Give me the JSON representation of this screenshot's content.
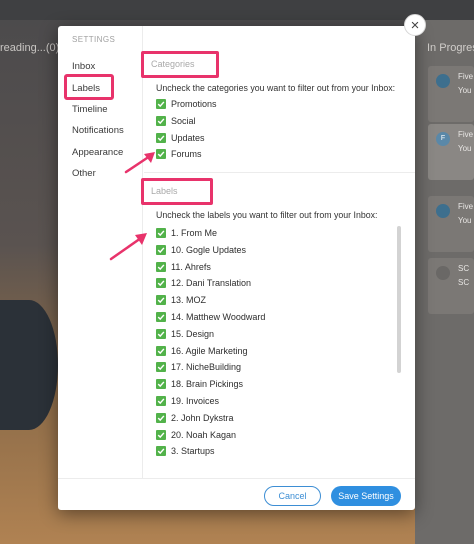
{
  "background": {
    "left_label": "reading...(0)",
    "right_title": "In Progress",
    "right_cards": [
      {
        "avatar_letter": "",
        "line1": "Five",
        "line2": "You"
      },
      {
        "avatar_letter": "F",
        "line1": "Five",
        "line2": "You"
      },
      {
        "avatar_letter": "",
        "line1": "Five",
        "line2": "You"
      },
      {
        "avatar_letter": "",
        "line1": "SC",
        "line2": "SC"
      }
    ]
  },
  "modal": {
    "close_icon": "×",
    "sidebar": {
      "heading": "SETTINGS",
      "items": [
        {
          "label": "Inbox"
        },
        {
          "label": "Labels"
        },
        {
          "label": "Timeline"
        },
        {
          "label": "Notifications"
        },
        {
          "label": "Appearance"
        },
        {
          "label": "Other"
        }
      ]
    },
    "categories": {
      "title": "Categories",
      "instruction": "Uncheck the categories you want to filter out from your Inbox:",
      "items": [
        {
          "label": "Promotions",
          "checked": true
        },
        {
          "label": "Social",
          "checked": true
        },
        {
          "label": "Updates",
          "checked": true
        },
        {
          "label": "Forums",
          "checked": true
        }
      ]
    },
    "labels": {
      "title": "Labels",
      "instruction": "Uncheck the labels you want to filter out from your Inbox:",
      "items": [
        {
          "label": "1. From Me",
          "checked": true
        },
        {
          "label": "10. Gogle Updates",
          "checked": true
        },
        {
          "label": "11. Ahrefs",
          "checked": true
        },
        {
          "label": "12. Dani Translation",
          "checked": true
        },
        {
          "label": "13. MOZ",
          "checked": true
        },
        {
          "label": "14. Matthew Woodward",
          "checked": true
        },
        {
          "label": "15. Design",
          "checked": true
        },
        {
          "label": "16. Agile Marketing",
          "checked": true
        },
        {
          "label": "17. NicheBuilding",
          "checked": true
        },
        {
          "label": "18. Brain Pickings",
          "checked": true
        },
        {
          "label": "19. Invoices",
          "checked": true
        },
        {
          "label": "2. John Dykstra",
          "checked": true
        },
        {
          "label": "20. Noah Kagan",
          "checked": true
        },
        {
          "label": "3. Startups",
          "checked": true
        }
      ]
    },
    "footer": {
      "cancel_label": "Cancel",
      "save_label": "Save Settings"
    }
  },
  "colors": {
    "highlight": "#e8336b",
    "checkbox": "#52b24a",
    "primary": "#2f8fe0"
  },
  "icons": {
    "close": "close-icon",
    "check": "checkmark-icon",
    "annotation": "pink-arrow-icon"
  }
}
